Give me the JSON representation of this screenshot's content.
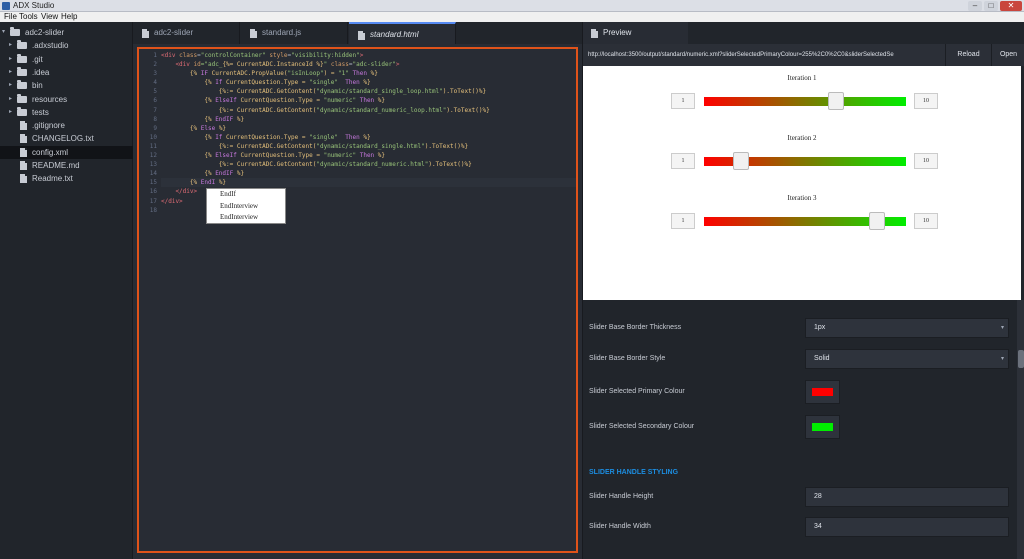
{
  "window": {
    "title": "ADX Studio",
    "min": "–",
    "max": "□",
    "close": "✕"
  },
  "menu": [
    "File",
    "Tools",
    "View",
    "Help"
  ],
  "colors": {
    "accent": "#568af2",
    "highlight_frame": "#e0531a",
    "section_heading": "#1c8de0"
  },
  "sidebar": {
    "items": [
      {
        "label": "adc2-slider",
        "type": "root",
        "arrow": "▾"
      },
      {
        "label": ".adxstudio",
        "type": "folder",
        "arrow": "▸"
      },
      {
        "label": ".git",
        "type": "folder",
        "arrow": "▸"
      },
      {
        "label": ".idea",
        "type": "folder",
        "arrow": "▸"
      },
      {
        "label": "bin",
        "type": "folder",
        "arrow": "▸"
      },
      {
        "label": "resources",
        "type": "folder",
        "arrow": "▸"
      },
      {
        "label": "tests",
        "type": "folder",
        "arrow": "▸"
      },
      {
        "label": ".gitignore",
        "type": "file"
      },
      {
        "label": "CHANGELOG.txt",
        "type": "file"
      },
      {
        "label": "config.xml",
        "type": "file",
        "selected": true
      },
      {
        "label": "README.md",
        "type": "file"
      },
      {
        "label": "Readme.txt",
        "type": "file"
      }
    ]
  },
  "editor": {
    "tabs": [
      {
        "label": "adc2-slider",
        "active": false
      },
      {
        "label": "standard.js",
        "active": false
      },
      {
        "label": "standard.html",
        "active": true
      }
    ],
    "current_line": 15,
    "lines": [
      [
        [
          "<div ",
          "#e06c75"
        ],
        [
          "class",
          "#d19a66"
        ],
        [
          "=",
          "#abb2bf"
        ],
        [
          "\"controlContainer\"",
          "#98c379"
        ],
        [
          " style",
          "#d19a66"
        ],
        [
          "=",
          "#abb2bf"
        ],
        [
          "\"visibility:hidden\"",
          "#98c379"
        ],
        [
          ">",
          "#e06c75"
        ]
      ],
      [
        [
          "    <div ",
          "#e06c75"
        ],
        [
          "id",
          "#d19a66"
        ],
        [
          "=\"adc_",
          "#98c379"
        ],
        [
          "{%= CurrentADC.InstanceId %}",
          "#e5c07b"
        ],
        [
          "\" ",
          "#98c379"
        ],
        [
          "class",
          "#d19a66"
        ],
        [
          "=",
          "#abb2bf"
        ],
        [
          "\"adc-slider\"",
          "#98c379"
        ],
        [
          ">",
          "#e06c75"
        ]
      ],
      [
        [
          "        {% ",
          "#e5c07b"
        ],
        [
          "IF",
          "#c678dd"
        ],
        [
          " CurrentADC.PropValue(",
          "#e5c07b"
        ],
        [
          "\"isInLoop\"",
          "#98c379"
        ],
        [
          ") = ",
          "#e5c07b"
        ],
        [
          "\"1\"",
          "#98c379"
        ],
        [
          " ",
          "#e5c07b"
        ],
        [
          "Then",
          "#c678dd"
        ],
        [
          " %}",
          "#e5c07b"
        ]
      ],
      [
        [
          "            {% ",
          "#e5c07b"
        ],
        [
          "If",
          "#c678dd"
        ],
        [
          " CurrentQuestion.Type = ",
          "#e5c07b"
        ],
        [
          "\"single\"",
          "#98c379"
        ],
        [
          "  ",
          "#e5c07b"
        ],
        [
          "Then",
          "#c678dd"
        ],
        [
          " %}",
          "#e5c07b"
        ]
      ],
      [
        [
          "                {%:= CurrentADC.GetContent(",
          "#e5c07b"
        ],
        [
          "\"dynamic/standard_single_loop.html\"",
          "#98c379"
        ],
        [
          ").ToText()%}",
          "#e5c07b"
        ]
      ],
      [
        [
          "            {% ",
          "#e5c07b"
        ],
        [
          "ElseIf",
          "#c678dd"
        ],
        [
          " CurrentQuestion.Type = ",
          "#e5c07b"
        ],
        [
          "\"numeric\"",
          "#98c379"
        ],
        [
          " ",
          "#e5c07b"
        ],
        [
          "Then",
          "#c678dd"
        ],
        [
          " %}",
          "#e5c07b"
        ]
      ],
      [
        [
          "                {%:= CurrentADC.GetContent(",
          "#e5c07b"
        ],
        [
          "\"dynamic/standard_numeric_loop.html\"",
          "#98c379"
        ],
        [
          ").ToText()%}",
          "#e5c07b"
        ]
      ],
      [
        [
          "            {% ",
          "#e5c07b"
        ],
        [
          "EndIF",
          "#c678dd"
        ],
        [
          " %}",
          "#e5c07b"
        ]
      ],
      [
        [
          "        {% ",
          "#e5c07b"
        ],
        [
          "Else",
          "#c678dd"
        ],
        [
          " %}",
          "#e5c07b"
        ]
      ],
      [
        [
          "            {% ",
          "#e5c07b"
        ],
        [
          "If",
          "#c678dd"
        ],
        [
          " CurrentQuestion.Type = ",
          "#e5c07b"
        ],
        [
          "\"single\"",
          "#98c379"
        ],
        [
          "  ",
          "#e5c07b"
        ],
        [
          "Then",
          "#c678dd"
        ],
        [
          " %}",
          "#e5c07b"
        ]
      ],
      [
        [
          "                {%:= CurrentADC.GetContent(",
          "#e5c07b"
        ],
        [
          "\"dynamic/standard_single.html\"",
          "#98c379"
        ],
        [
          ").ToText()%}",
          "#e5c07b"
        ]
      ],
      [
        [
          "            {% ",
          "#e5c07b"
        ],
        [
          "ElseIf",
          "#c678dd"
        ],
        [
          " CurrentQuestion.Type = ",
          "#e5c07b"
        ],
        [
          "\"numeric\"",
          "#98c379"
        ],
        [
          " ",
          "#e5c07b"
        ],
        [
          "Then",
          "#c678dd"
        ],
        [
          " %}",
          "#e5c07b"
        ]
      ],
      [
        [
          "                {%:= CurrentADC.GetContent(",
          "#e5c07b"
        ],
        [
          "\"dynamic/standard_numeric.html\"",
          "#98c379"
        ],
        [
          ").ToText()%}",
          "#e5c07b"
        ]
      ],
      [
        [
          "            {% ",
          "#e5c07b"
        ],
        [
          "EndIF",
          "#c678dd"
        ],
        [
          " %}",
          "#e5c07b"
        ]
      ],
      [
        [
          "        {% ",
          "#e5c07b"
        ],
        [
          "EndI",
          "#c678dd"
        ],
        [
          " %}",
          "#e5c07b"
        ]
      ],
      [
        [
          "    </div>",
          "#e06c75"
        ]
      ],
      [
        [
          "</div>",
          "#e06c75"
        ]
      ],
      []
    ],
    "autocomplete": [
      "EndIf",
      "EndInterview",
      "EndInterview"
    ]
  },
  "preview": {
    "tab_label": "Preview",
    "url": "http://localhost:3500/output/standard/numeric.xml?sliderSelectedPrimaryColour=255%2C0%2C0&sliderSelectedSe",
    "reload_label": "Reload",
    "open_label": "Open",
    "slider_colors": {
      "primary": "#ff0000",
      "secondary": "#00ee00"
    },
    "iterations": [
      {
        "title": "Iteration 1",
        "min": "1",
        "max": "10",
        "value": 7
      },
      {
        "title": "Iteration 2",
        "min": "1",
        "max": "10",
        "value": 2.4
      },
      {
        "title": "Iteration 3",
        "min": "1",
        "max": "10",
        "value": 9
      }
    ]
  },
  "properties": {
    "rows": [
      {
        "kind": "select",
        "label": "Slider Base Border Thickness",
        "value": "1px",
        "caret": "▾"
      },
      {
        "kind": "select",
        "label": "Slider Base Border Style",
        "value": "Solid",
        "caret": "▾"
      },
      {
        "kind": "color",
        "label": "Slider Selected Primary Colour",
        "color": "#ff0000"
      },
      {
        "kind": "color",
        "label": "Slider Selected Secondary Colour",
        "color": "#00ee00"
      },
      {
        "kind": "section",
        "label": "SLIDER HANDLE STYLING"
      },
      {
        "kind": "input",
        "label": "Slider Handle Height",
        "value": "28"
      },
      {
        "kind": "input",
        "label": "Slider Handle Width",
        "value": "34"
      }
    ]
  }
}
